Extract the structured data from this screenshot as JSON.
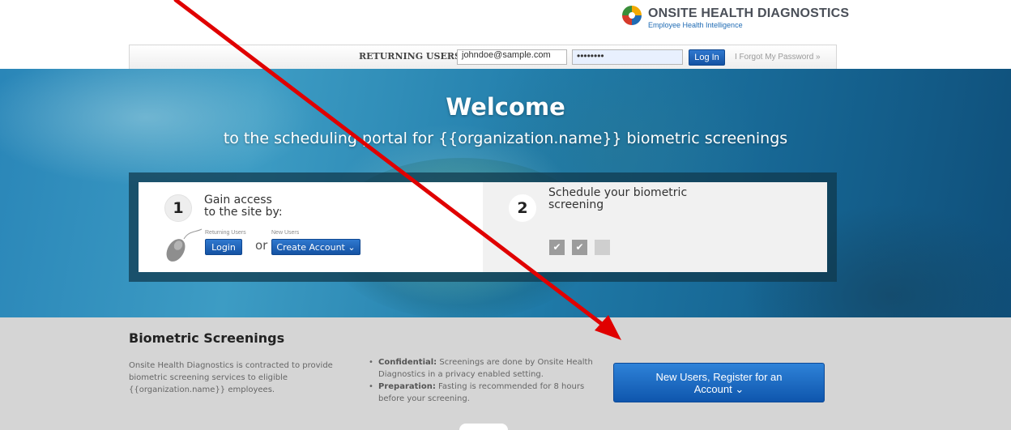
{
  "logo": {
    "brand": "ONSITE HEALTH DIAGNOSTICS",
    "tagline": "Employee Health Intelligence"
  },
  "login_bar": {
    "label": "RETURNING USERS:",
    "email_value": "johndoe@sample.com",
    "password_value": "••••••••",
    "login_button": "Log In",
    "forgot_link": "I Forgot My Password »"
  },
  "hero": {
    "title": "Welcome",
    "subtitle": "to the scheduling portal for {{organization.name}} biometric screenings"
  },
  "steps": {
    "step1": {
      "number": "1",
      "line1": "Gain access",
      "line2": "to the site by:",
      "returning_label": "Returning Users",
      "new_label": "New Users",
      "login_button": "Login",
      "or_text": "or",
      "create_button": "Create Account ⌄"
    },
    "step2": {
      "number": "2",
      "line1": "Schedule your biometric",
      "line2": "screening",
      "checkbox_states": [
        "checked",
        "checked",
        "empty"
      ],
      "check_glyph": "✔"
    }
  },
  "info": {
    "title": "Biometric Screenings",
    "description": "Onsite Health Diagnostics is contracted to provide biometric screening services to eligible {{organization.name}} employees.",
    "bullets": [
      {
        "term": "Confidential:",
        "text": " Screenings are done by Onsite Health Diagnostics in a privacy enabled setting."
      },
      {
        "term": "Preparation:",
        "text": " Fasting is recommended for 8 hours before your screening."
      }
    ],
    "register_line1": "New Users, Register for an",
    "register_line2": "Account ⌄"
  },
  "colors": {
    "accent_blue": "#1553a3",
    "annotation_red": "#e00000",
    "hero_blue": "#2a86b8",
    "info_bg": "#d5d5d5"
  },
  "icons": [
    "logo-mark-icon",
    "computer-mouse-icon",
    "checkmark-icon",
    "chevron-down-icon",
    "red-arrow-annotation"
  ]
}
